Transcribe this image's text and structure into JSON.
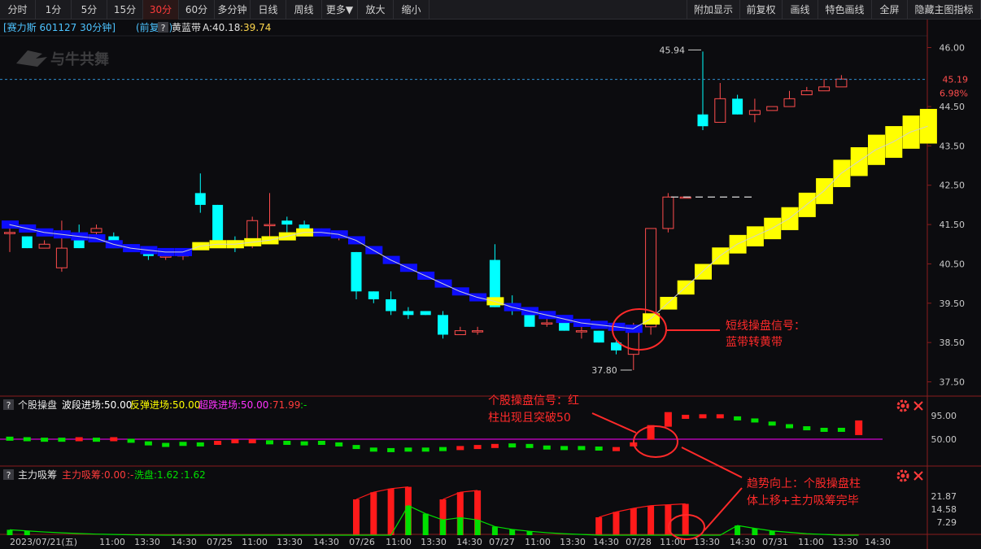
{
  "toolbar": {
    "left": [
      "分时",
      "1分",
      "5分",
      "15分",
      "30分",
      "60分",
      "多分钟",
      "日线",
      "周线",
      "更多▼",
      "放大",
      "缩小"
    ],
    "right": [
      "附加显示",
      "前复权",
      "画线",
      "特色画线",
      "全屏",
      "隐藏主图指标"
    ],
    "active": "30分"
  },
  "header": {
    "stock": "[赛力斯 601127 30分钟]",
    "adjust": "(前复权)",
    "help": "?",
    "indicator": "黄蓝带",
    "a_label": "A:40.18",
    "b_label": ":39.74",
    "watermark": "与牛共舞"
  },
  "price_labels": {
    "high": "45.94",
    "low": "37.80",
    "current": "45.19",
    "current_pct": "6.98%"
  },
  "annotations": {
    "short_signal": [
      "短线操盘信号：",
      "蓝带转黄带"
    ],
    "stock_signal": [
      "个股操盘信号：红",
      "柱出现且突破50"
    ],
    "trend_up": [
      "趋势向上：个股操盘柱",
      "体上移+主力吸筹完毕"
    ]
  },
  "panel2": {
    "help": "?",
    "name": "个股操盘",
    "l1": "波段进场:50.00",
    "l2": "反弹进场:50.00",
    "l3": "超跌进场:50.00",
    "l4": ":71.99",
    "l5": ":-"
  },
  "panel3": {
    "help": "?",
    "name": "主力吸筹",
    "l1": "主力吸筹:0.00",
    "l2": ":-",
    "l3": "洗盘:1.62",
    "l4": ":1.62"
  },
  "colors": {
    "up": "#ff4d4d",
    "down": "#00ffff",
    "yellow": "#ffff00",
    "blue": "#0d0dff",
    "green": "#00e000",
    "red": "#ff1a1a",
    "magenta": "#ff00ff",
    "annotation": "#ff2a2a"
  },
  "chart_data": {
    "type": "candlestick",
    "y_axis_main": {
      "range": [
        37.2,
        46.3
      ],
      "ticks": [
        "46.00",
        "44.50",
        "43.50",
        "42.50",
        "41.50",
        "40.50",
        "39.50",
        "38.50",
        "37.50"
      ]
    },
    "y_axis_ind1": {
      "ticks": [
        "95.00",
        "50.00"
      ]
    },
    "y_axis_ind2": {
      "ticks": [
        "21.87",
        "14.58",
        "7.29"
      ]
    },
    "x_axis_labels": [
      "2023/07/21(五)",
      "11:00",
      "13:30",
      "14:30",
      "07/25",
      "11:00",
      "13:30",
      "14:30",
      "07/26",
      "11:00",
      "13:30",
      "14:30",
      "07/27",
      "11:00",
      "13:30",
      "14:30",
      "07/28",
      "11:00",
      "13:30",
      "14:30",
      "07/31",
      "11:00",
      "13:30",
      "14:30"
    ],
    "candles": [
      [
        41.3,
        41.3,
        41.4,
        40.8
      ],
      [
        41.2,
        40.9,
        41.2,
        40.9
      ],
      [
        40.9,
        41.0,
        41.1,
        40.9
      ],
      [
        40.4,
        40.9,
        41.6,
        40.3
      ],
      [
        41.2,
        40.9,
        41.5,
        40.9
      ],
      [
        41.3,
        41.4,
        41.5,
        41.1
      ],
      [
        41.2,
        40.9,
        41.3,
        40.9
      ],
      [
        40.9,
        40.8,
        41.0,
        40.8
      ],
      [
        40.8,
        40.7,
        40.9,
        40.6
      ],
      [
        40.7,
        40.7,
        40.8,
        40.6
      ],
      [
        40.7,
        40.8,
        40.9,
        40.6
      ],
      [
        42.3,
        42.0,
        42.8,
        41.8
      ],
      [
        42.0,
        41.1,
        42.0,
        41.1
      ],
      [
        41.1,
        41.0,
        41.2,
        40.8
      ],
      [
        41.0,
        41.6,
        41.7,
        40.9
      ],
      [
        41.5,
        41.5,
        42.3,
        41.1
      ],
      [
        41.6,
        41.5,
        41.7,
        41.3
      ],
      [
        41.5,
        41.4,
        41.6,
        41.3
      ],
      [
        41.3,
        41.3,
        41.4,
        41.2
      ],
      [
        41.2,
        41.2,
        41.2,
        41.1
      ],
      [
        40.8,
        39.8,
        40.8,
        39.6
      ],
      [
        39.8,
        39.6,
        39.8,
        39.5
      ],
      [
        39.6,
        39.3,
        39.8,
        39.2
      ],
      [
        39.3,
        39.2,
        39.4,
        39.1
      ],
      [
        39.3,
        39.2,
        39.3,
        39.2
      ],
      [
        39.2,
        38.7,
        39.3,
        38.6
      ],
      [
        38.7,
        38.8,
        38.9,
        38.7
      ],
      [
        38.8,
        38.8,
        38.9,
        38.7
      ],
      [
        40.6,
        39.4,
        41.0,
        39.4
      ],
      [
        39.5,
        39.3,
        39.7,
        39.2
      ],
      [
        39.3,
        38.9,
        39.4,
        38.9
      ],
      [
        39.0,
        39.0,
        39.2,
        38.9
      ],
      [
        39.0,
        38.8,
        39.0,
        38.8
      ],
      [
        38.8,
        38.8,
        38.9,
        38.6
      ],
      [
        38.8,
        38.5,
        38.8,
        38.5
      ],
      [
        38.5,
        38.3,
        38.6,
        38.2
      ],
      [
        38.2,
        38.9,
        39.0,
        37.8
      ],
      [
        38.9,
        41.4,
        41.4,
        38.7
      ],
      [
        41.4,
        42.2,
        42.3,
        41.3
      ],
      [
        42.2,
        42.2,
        42.2,
        42.2
      ],
      [
        44.3,
        44.0,
        45.9,
        43.9
      ],
      [
        44.1,
        44.7,
        45.1,
        44.1
      ],
      [
        44.7,
        44.3,
        44.8,
        44.3
      ],
      [
        44.3,
        44.4,
        44.7,
        44.1
      ],
      [
        44.4,
        44.5,
        44.5,
        44.4
      ],
      [
        44.5,
        44.7,
        44.9,
        44.5
      ],
      [
        44.8,
        44.9,
        45.0,
        44.8
      ],
      [
        44.9,
        45.0,
        45.2,
        44.9
      ],
      [
        45.0,
        45.2,
        45.3,
        45.0
      ]
    ],
    "band": [
      [
        41.5,
        "blue"
      ],
      [
        41.4,
        "blue"
      ],
      [
        41.3,
        "blue"
      ],
      [
        41.25,
        "blue"
      ],
      [
        41.2,
        "blue"
      ],
      [
        41.15,
        "blue"
      ],
      [
        41.0,
        "blue"
      ],
      [
        40.9,
        "blue"
      ],
      [
        40.85,
        "blue"
      ],
      [
        40.8,
        "blue"
      ],
      [
        40.8,
        "blue"
      ],
      [
        40.95,
        "yellow"
      ],
      [
        41.0,
        "yellow"
      ],
      [
        41.0,
        "yellow"
      ],
      [
        41.05,
        "yellow"
      ],
      [
        41.1,
        "yellow"
      ],
      [
        41.2,
        "yellow"
      ],
      [
        41.3,
        "yellow"
      ],
      [
        41.3,
        "blue"
      ],
      [
        41.25,
        "blue"
      ],
      [
        41.1,
        "blue"
      ],
      [
        40.85,
        "blue"
      ],
      [
        40.6,
        "blue"
      ],
      [
        40.4,
        "blue"
      ],
      [
        40.2,
        "blue"
      ],
      [
        40.0,
        "blue"
      ],
      [
        39.8,
        "blue"
      ],
      [
        39.65,
        "blue"
      ],
      [
        39.55,
        "yellow"
      ],
      [
        39.4,
        "blue"
      ],
      [
        39.3,
        "blue"
      ],
      [
        39.2,
        "blue"
      ],
      [
        39.1,
        "blue"
      ],
      [
        39.0,
        "blue"
      ],
      [
        38.95,
        "blue"
      ],
      [
        38.9,
        "blue"
      ],
      [
        38.85,
        "blue"
      ],
      [
        39.1,
        "yellow"
      ],
      [
        39.5,
        "yellow"
      ],
      [
        39.9,
        "yellow"
      ],
      [
        40.3,
        "yellow"
      ],
      [
        40.7,
        "yellow"
      ],
      [
        41.0,
        "yellow"
      ],
      [
        41.2,
        "yellow"
      ],
      [
        41.4,
        "yellow"
      ],
      [
        41.65,
        "yellow"
      ],
      [
        42.0,
        "yellow"
      ],
      [
        42.35,
        "yellow"
      ],
      [
        42.8,
        "yellow"
      ],
      [
        43.1,
        "yellow"
      ],
      [
        43.4,
        "yellow"
      ],
      [
        43.6,
        "yellow"
      ],
      [
        43.85,
        "yellow"
      ],
      [
        44.0,
        "yellow"
      ]
    ],
    "ind1_bars": [
      [
        51,
        "green"
      ],
      [
        50,
        "green"
      ],
      [
        49,
        "green"
      ],
      [
        49,
        "green"
      ],
      [
        50,
        "red"
      ],
      [
        49,
        "green"
      ],
      [
        50,
        "red"
      ],
      [
        47,
        "green"
      ],
      [
        42,
        "green"
      ],
      [
        39,
        "green"
      ],
      [
        41,
        "green"
      ],
      [
        40,
        "green"
      ],
      [
        43,
        "red"
      ],
      [
        46,
        "red"
      ],
      [
        46,
        "red"
      ],
      [
        44,
        "green"
      ],
      [
        43,
        "green"
      ],
      [
        42,
        "green"
      ],
      [
        43,
        "green"
      ],
      [
        40,
        "green"
      ],
      [
        35,
        "green"
      ],
      [
        30,
        "green"
      ],
      [
        29,
        "green"
      ],
      [
        30,
        "green"
      ],
      [
        30,
        "green"
      ],
      [
        31,
        "green"
      ],
      [
        33,
        "red"
      ],
      [
        35,
        "red"
      ],
      [
        37,
        "red"
      ],
      [
        38,
        "green"
      ],
      [
        37,
        "green"
      ],
      [
        34,
        "green"
      ],
      [
        33,
        "green"
      ],
      [
        33,
        "green"
      ],
      [
        32,
        "green"
      ],
      [
        31,
        "red"
      ],
      [
        40,
        "red"
      ],
      [
        63,
        "red"
      ],
      [
        88,
        "red"
      ],
      [
        93,
        "red"
      ],
      [
        94,
        "red"
      ],
      [
        94,
        "red"
      ],
      [
        90,
        "green"
      ],
      [
        86,
        "green"
      ],
      [
        80,
        "green"
      ],
      [
        75,
        "green"
      ],
      [
        71,
        "green"
      ],
      [
        68,
        "green"
      ],
      [
        68,
        "green"
      ],
      [
        72,
        "red"
      ]
    ],
    "ind2_red": [
      0,
      0,
      0,
      0,
      0,
      0,
      0,
      0,
      0,
      0,
      0,
      0,
      0,
      0,
      0,
      0,
      0,
      0,
      0,
      0,
      20.0,
      24.0,
      26.0,
      27.0,
      0,
      20.0,
      24.0,
      25.0,
      0,
      0,
      0,
      0,
      0,
      0,
      10.0,
      13.0,
      15.0,
      16.5,
      17.0,
      17.5,
      0,
      0,
      0,
      0,
      0,
      0,
      0,
      0,
      0,
      0
    ],
    "ind2_green": [
      3.0,
      2.4,
      1.8,
      1.3,
      0.9,
      0.6,
      0.4,
      0.2,
      0.1,
      0,
      0,
      0,
      0,
      0,
      0,
      0,
      0,
      0,
      0,
      0,
      0,
      0,
      0,
      16.5,
      12.0,
      8.5,
      9.8,
      8.5,
      4.8,
      3.2,
      2.2,
      1.4,
      0.8,
      0.4,
      0,
      0,
      0,
      0,
      0,
      0,
      0,
      0,
      5.4,
      3.8,
      2.4,
      1.6,
      0.8,
      0.4,
      0,
      0
    ]
  }
}
